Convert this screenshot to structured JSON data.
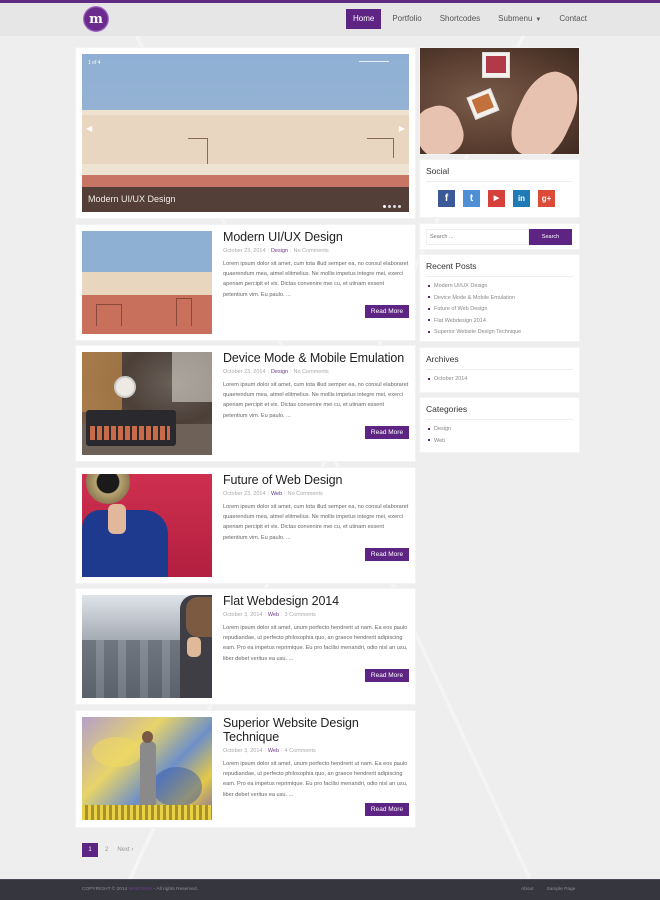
{
  "header": {
    "logo_letter": "m",
    "nav": [
      {
        "label": "Home",
        "active": true
      },
      {
        "label": "Portfolio"
      },
      {
        "label": "Shortcodes"
      },
      {
        "label": "Submenu",
        "has_dropdown": true
      },
      {
        "label": "Contact"
      }
    ],
    "dropdown_glyph": "▼"
  },
  "slider": {
    "counter": "1 of 4",
    "caption": "Modern UI/UX Design",
    "prev_glyph": "◀",
    "next_glyph": "▶",
    "slide_count": 4,
    "current_slide": 1
  },
  "posts": [
    {
      "title": "Modern UI/UX Design",
      "date": "October 23, 2014",
      "category": "Design",
      "comments": "No Comments",
      "excerpt": "Lorem ipsum dolor sit amet, cum tota illud semper ea, no consul elaboraret quaerendum mea, atmel elitmelius. Ne mollis impetus integre mei, exerci aperiam percipit et vix. Dictas convenire mei cu, et utinam essent petentium vim. Eu paulo. ...",
      "read_more": "Read More"
    },
    {
      "title": "Device Mode & Mobile Emulation",
      "date": "October 23, 2014",
      "category": "Design",
      "comments": "No Comments",
      "excerpt": "Lorem ipsum dolor sit amet, cum tota illud semper ea, no consul elaboraret quaerendum mea, atmel elitmelius. Ne mollis impetus integre mei, exerci aperiam percipit et vix. Dictas convenire mei cu, et utinam essent petentium vim. Eu paulo. ...",
      "read_more": "Read More"
    },
    {
      "title": "Future of Web Design",
      "date": "October 23, 2014",
      "category": "Web",
      "comments": "No Comments",
      "excerpt": "Lorem ipsum dolor sit amet, cum tota illud semper ea, no consul elaboraret quaerendum mea, atmel elitmelius. Ne mollis impetus integre mei, exerci aperiam percipit et vix. Dictas convenire mei cu, et utinam essent petentium vim. Eu paulo. ...",
      "read_more": "Read More"
    },
    {
      "title": "Flat Webdesign 2014",
      "date": "October 3, 2014",
      "category": "Web",
      "comments": "3 Comments",
      "excerpt": "Lorem ipsum dolor sit amet, unum perfecto hendrerit ut nam. Ea eos paulo repudiandae, ut perfecto philosophia quo, an graece hendrerit adipiscing eam. Pro ea impetus reprimique. Eu pro facilisi menandri, odio nisl an usu, liber debet veritus ea usu. ...",
      "read_more": "Read More"
    },
    {
      "title": "Superior Website Design Technique",
      "date": "October 3, 2014",
      "category": "Web",
      "comments": "4 Comments",
      "excerpt": "Lorem ipsum dolor sit amet, unum perfecto hendrerit ut nam. Ea eos paulo repudiandae, ut perfecto philosophia quo, an graece hendrerit adipiscing eam. Pro ea impetus reprimique. Eu pro facilisi menandri, odio nisl an usu, liber debet veritus ea usu. ...",
      "read_more": "Read More"
    }
  ],
  "sidebar": {
    "social": {
      "title": "Social",
      "icons": [
        {
          "name": "facebook",
          "glyph": "f",
          "color": "#3b5998"
        },
        {
          "name": "twitter",
          "glyph": "t",
          "color": "#4f8fd6"
        },
        {
          "name": "youtube",
          "glyph": "▶",
          "color": "#d6403a"
        },
        {
          "name": "linkedin",
          "glyph": "in",
          "color": "#1f7bb6"
        },
        {
          "name": "google-plus",
          "glyph": "g+",
          "color": "#dc4a38"
        }
      ]
    },
    "search": {
      "placeholder": "Search ...",
      "button": "Search"
    },
    "recent_posts": {
      "title": "Recent Posts",
      "items": [
        "Modern UI/UX Design",
        "Device Mode & Mobile Emulation",
        "Future of Web Design",
        "Flat Webdesign 2014",
        "Superior Website Design Technique"
      ]
    },
    "archives": {
      "title": "Archives",
      "items": [
        "October 2014"
      ]
    },
    "categories": {
      "title": "Categories",
      "items": [
        "Design",
        "Web"
      ]
    }
  },
  "pagination": {
    "pages": [
      "1",
      "2"
    ],
    "current": "1",
    "next": "Next ›"
  },
  "footer": {
    "copyright_prefix": "COPYRIGHT © 2014 ",
    "brand": "MAKOSUA",
    "copyright_suffix": " - All rights Reserved.",
    "links": [
      "About",
      "Sample Page"
    ]
  },
  "colors": {
    "accent": "#5e2483",
    "footer_bg": "#36363f",
    "page_bg": "#eeeeee"
  }
}
